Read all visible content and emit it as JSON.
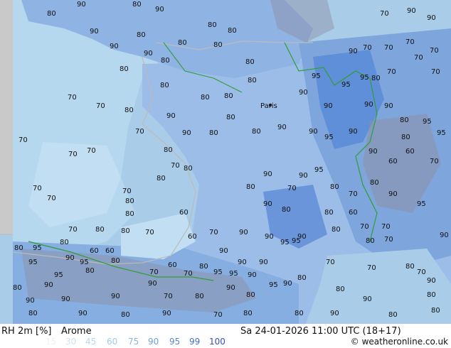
{
  "map": {
    "contour_labels": [
      "60",
      "70",
      "80",
      "90",
      "95"
    ],
    "city_label": "Paris",
    "colors": {
      "land_humid": "#7ea6dd",
      "land_mid": "#9bbde7",
      "sea": "#a9cde8",
      "land_dry": "#c2def2",
      "terrain_gray": "#8c8fa5",
      "border": "#2f9e37",
      "coast": "#bbbbbb"
    }
  },
  "footer": {
    "variable": "RH 2m [%]",
    "model": "Arome",
    "datetime": "Sa 24-01-2026 11:00 UTC (18+17)",
    "credit": "© weatheronline.co.uk",
    "legend": [
      {
        "label": "15",
        "color": "#eaf3f9"
      },
      {
        "label": "30",
        "color": "#cfe3f2"
      },
      {
        "label": "45",
        "color": "#b7d7ef"
      },
      {
        "label": "60",
        "color": "#9ecbeb"
      },
      {
        "label": "75",
        "color": "#86b9e5"
      },
      {
        "label": "90",
        "color": "#6f9fdf"
      },
      {
        "label": "95",
        "color": "#5a86d6"
      },
      {
        "label": "99",
        "color": "#456bc8"
      },
      {
        "label": "100",
        "color": "#3551b5"
      }
    ]
  }
}
